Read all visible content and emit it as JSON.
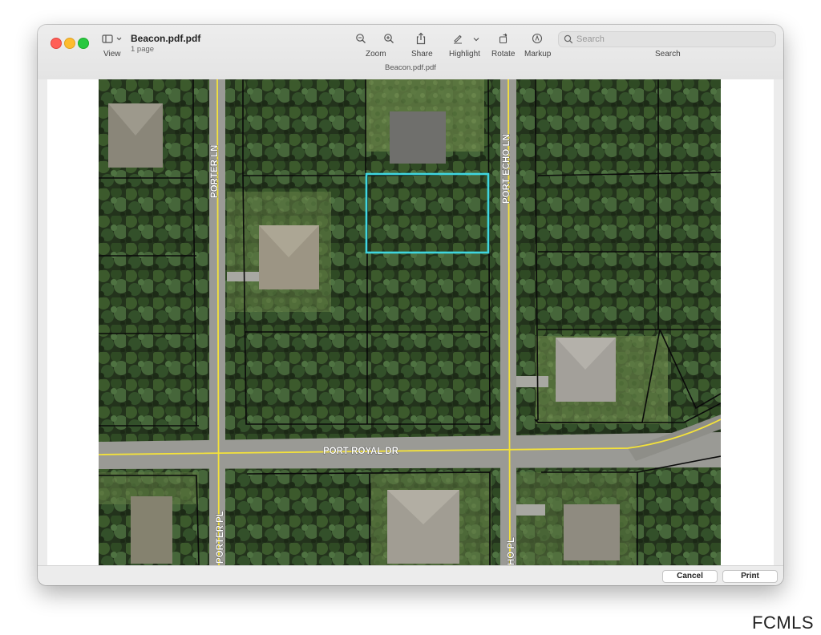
{
  "window": {
    "document_title": "Beacon.pdf.pdf",
    "page_count": "1 page",
    "filename_bar": "Beacon.pdf.pdf"
  },
  "toolbar": {
    "view_label": "View",
    "zoom_label": "Zoom",
    "share_label": "Share",
    "highlight_label": "Highlight",
    "rotate_label": "Rotate",
    "markup_label": "Markup",
    "search_label": "Search",
    "search_placeholder": "Search"
  },
  "map": {
    "streets": {
      "porter_ln": "PORTER LN",
      "port_echo_ln": "PORT ECHO LN",
      "port_royal_dr": "PORT ROYAL DR",
      "porter_pl": "PORTER PL",
      "echo_pl_fragment": "HO PL"
    },
    "highlight_color": "#3fd6e0",
    "road_line_color": "#f4e23a",
    "parcel_line_color": "#0a0a0a"
  },
  "footer": {
    "cancel_label": "Cancel",
    "print_label": "Print"
  },
  "watermark": "FCMLS"
}
